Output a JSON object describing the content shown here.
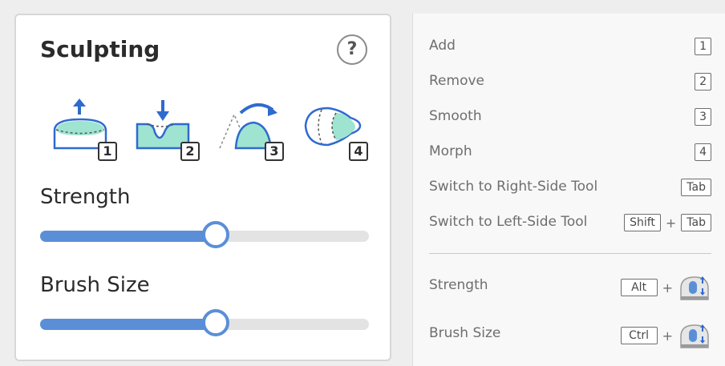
{
  "sculpting": {
    "title": "Sculpting",
    "help_label": "?",
    "tools": [
      {
        "name": "add",
        "key": "1",
        "icon": "sculpt-add-icon"
      },
      {
        "name": "remove",
        "key": "2",
        "icon": "sculpt-remove-icon"
      },
      {
        "name": "smooth",
        "key": "3",
        "icon": "sculpt-smooth-icon"
      },
      {
        "name": "morph",
        "key": "4",
        "icon": "sculpt-morph-icon"
      }
    ],
    "strength": {
      "label": "Strength",
      "value_fraction": 0.535
    },
    "brush_size": {
      "label": "Brush Size",
      "value_fraction": 0.535
    }
  },
  "shortcuts": {
    "rows": [
      {
        "label": "Add",
        "keys": [
          "1"
        ]
      },
      {
        "label": "Remove",
        "keys": [
          "2"
        ]
      },
      {
        "label": "Smooth",
        "keys": [
          "3"
        ]
      },
      {
        "label": "Morph",
        "keys": [
          "4"
        ]
      },
      {
        "label": "Switch to Right-Side Tool",
        "keys": [
          "Tab"
        ]
      },
      {
        "label": "Switch to Left-Side Tool",
        "keys": [
          "Shift",
          "Tab"
        ]
      }
    ],
    "plus": "+",
    "strength": {
      "label": "Strength",
      "key": "Alt",
      "icon": "mouse-wheel-icon"
    },
    "brush_size": {
      "label": "Brush Size",
      "key": "Ctrl",
      "icon": "mouse-wheel-icon"
    }
  },
  "colors": {
    "accent": "#5a8fd8",
    "icon_teal": "#9fe3d1",
    "icon_blue": "#2f6ad0"
  }
}
